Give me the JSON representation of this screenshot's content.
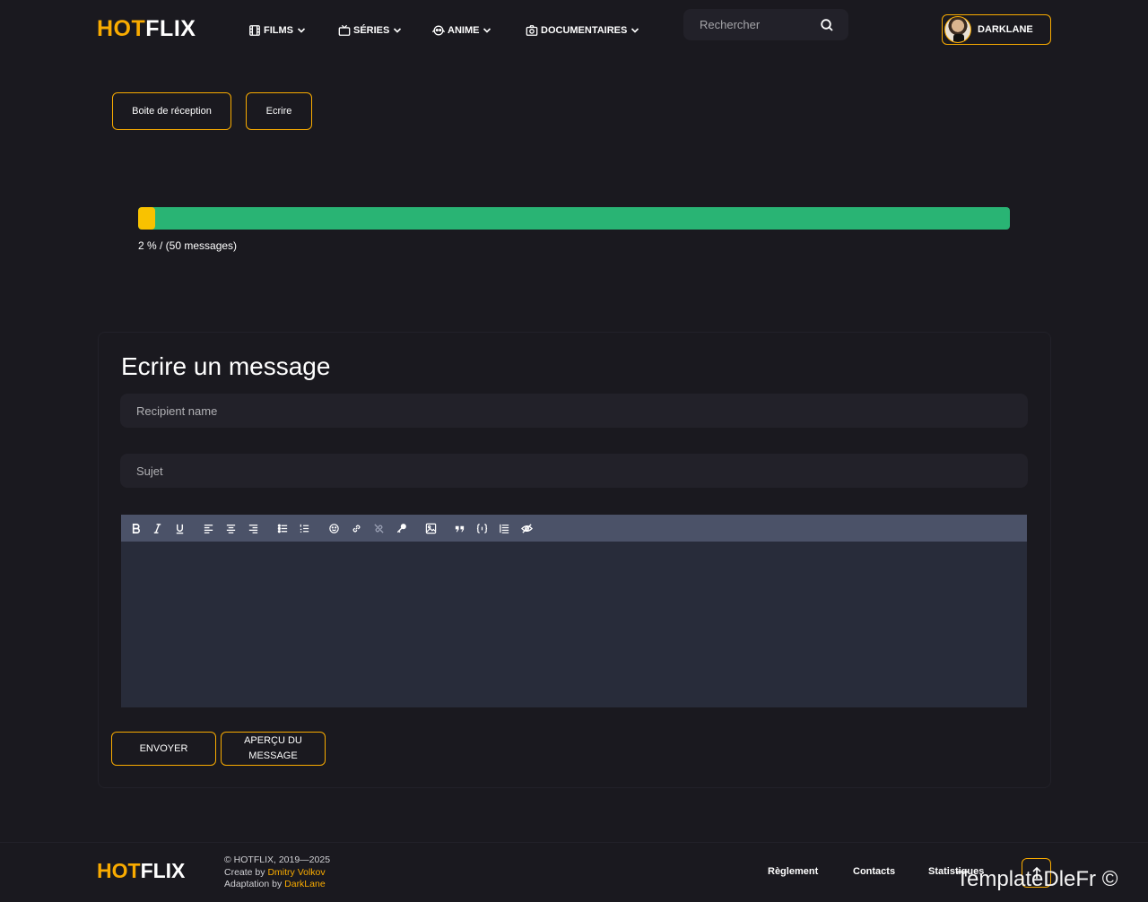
{
  "brand": {
    "logo_hot": "HOT",
    "logo_flix": "FLIX"
  },
  "nav": {
    "items": [
      {
        "label": "FILMS",
        "icon": "film-icon"
      },
      {
        "label": "SÉRIES",
        "icon": "tv-icon"
      },
      {
        "label": "ANIME",
        "icon": "anime-icon"
      },
      {
        "label": "DOCUMENTAIRES",
        "icon": "camera-icon"
      }
    ]
  },
  "search": {
    "placeholder": "Rechercher",
    "value": ""
  },
  "user": {
    "name": "DARKLANE"
  },
  "mailbox": {
    "inbox_label": "Boite de réception",
    "write_label": "Ecrire"
  },
  "quota": {
    "percent": 2,
    "text": "2 % / (50 messages)"
  },
  "compose": {
    "title": "Ecrire un message",
    "recipient_placeholder": "Recipient name",
    "subject_placeholder": "Sujet",
    "send_label": "ENVOYER",
    "preview_label_line1": "APERÇU DU",
    "preview_label_line2": "MESSAGE",
    "toolbar": [
      "bold",
      "italic",
      "underline",
      "align-left",
      "align-center",
      "align-right",
      "bullet-list",
      "numbered-list",
      "emoji",
      "link",
      "unlink",
      "key",
      "image",
      "quote",
      "code",
      "table",
      "hide"
    ]
  },
  "footer": {
    "logo_hot": "HOT",
    "logo_flix": "FLIX",
    "copyright": "© HOTFLIX, 2019—2025",
    "created_prefix": "Create by ",
    "created_name": "Dmitry Volkov",
    "adapted_prefix": "Adaptation by ",
    "adapted_name": "DarkLane",
    "links": [
      "Règlement",
      "Contacts",
      "Statistiques"
    ],
    "watermark": "TemplateDleFr ©"
  },
  "colors": {
    "accent": "#f9ab00",
    "progress_bg": "#29b474",
    "progress_fill": "#f9c200",
    "background": "#1a191f",
    "field": "#222129",
    "toolbar": "#4b5268",
    "editor": "#282c3a"
  }
}
